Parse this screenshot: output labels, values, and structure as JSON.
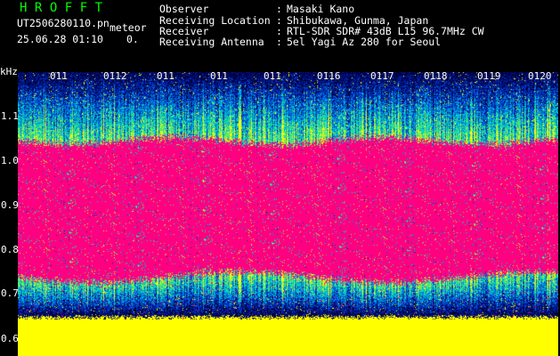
{
  "header": {
    "app_title": "HROFFT",
    "filename": "UT2506280110.pn",
    "mode": "meteor",
    "timestamp": "25.06.28 01:10",
    "count": "0."
  },
  "station_info": [
    {
      "label": "Observer",
      "separator": ":",
      "value": "Masaki Kano"
    },
    {
      "label": "Receiving Location",
      "separator": ":",
      "value": "Shibukawa, Gunma, Japan"
    },
    {
      "label": "Receiver",
      "separator": ":",
      "value": "RTL-SDR SDR# 43dB L15 96.7MHz CW"
    },
    {
      "label": "Receiving Antenna",
      "separator": ":",
      "value": "5el Yagi Az 280 for Seoul"
    }
  ],
  "axis": {
    "unit": "kHz",
    "ticks": [
      "1.1",
      "1.0",
      "0.9",
      "0.8",
      "0.7",
      "0.6"
    ]
  },
  "time_labels": [
    "011",
    "0112",
    "011",
    "011",
    "011",
    "0116",
    "0117",
    "0118",
    "0119",
    "0120"
  ],
  "colors": {
    "title_green": "#00ff00",
    "text_white": "#ffffff",
    "background": "#000000",
    "signal_magenta": "#ff0080",
    "floor_yellow": "#ffff00",
    "noise_blue": "#0033cc"
  }
}
